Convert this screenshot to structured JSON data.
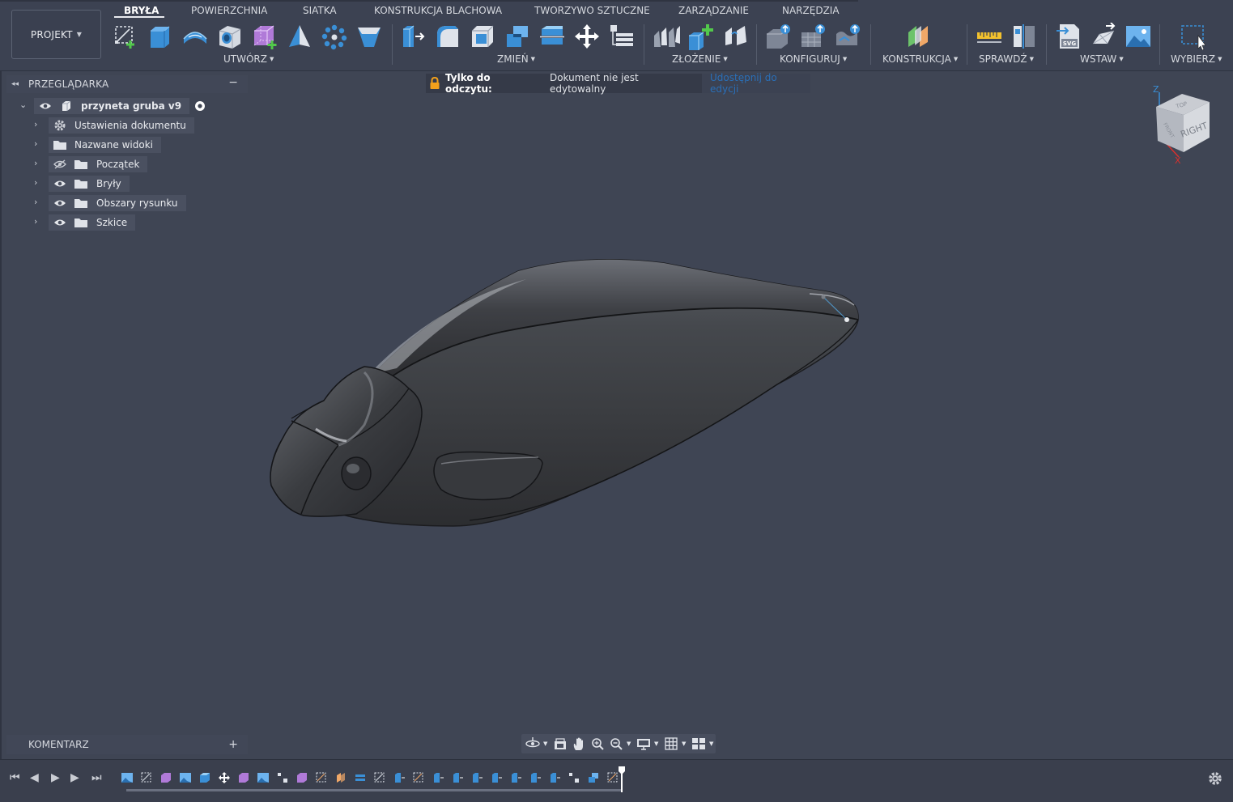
{
  "toolbar": {
    "project_button": "PROJEKT",
    "tabs": [
      "BRYŁA",
      "POWIERZCHNIA",
      "SIATKA",
      "KONSTRUKCJA BLACHOWA",
      "TWORZYWO SZTUCZNE",
      "ZARZĄDZANIE",
      "NARZĘDZIA"
    ],
    "active_tab": "BRYŁA",
    "groups": [
      "UTWÓRZ",
      "ZMIEŃ",
      "ZŁOŻENIE",
      "KONFIGURUJ",
      "KONSTRUKCJA",
      "SPRAWDŹ",
      "WSTAW",
      "WYBIERZ"
    ],
    "icons": {
      "create": [
        "create-sketch-icon",
        "extrude-icon",
        "revolve-icon",
        "hole-icon",
        "create-form-icon",
        "pyramid-icon",
        "pattern-icon",
        "shell-create-icon"
      ],
      "modify": [
        "press-pull-icon",
        "fillet-icon",
        "shell-icon",
        "combine-icon",
        "split-body-icon",
        "move-icon",
        "parameters-icon"
      ],
      "assemble": [
        "joint-icon",
        "new-component-icon",
        "rigid-group-icon"
      ],
      "configure": [
        "configure-table-icon",
        "configure-rows-icon",
        "configure-theme-icon"
      ],
      "construct": [
        "offset-plane-icon"
      ],
      "inspect": [
        "measure-icon",
        "section-analysis-icon"
      ],
      "insert": [
        "insert-svg-icon",
        "insert-mesh-icon",
        "insert-image-icon"
      ],
      "select": [
        "select-box-icon"
      ]
    },
    "svg_badge": "SVG"
  },
  "browser": {
    "title": "PRZEGLĄDARKA",
    "root": "przyneta gruba v9",
    "items": [
      {
        "label": "Ustawienia dokumentu",
        "icon": "gear-icon",
        "eye": "none"
      },
      {
        "label": "Nazwane widoki",
        "icon": "folder-icon",
        "eye": "none"
      },
      {
        "label": "Początek",
        "icon": "folder-icon",
        "eye": "hidden"
      },
      {
        "label": "Bryły",
        "icon": "folder-icon",
        "eye": "visible"
      },
      {
        "label": "Obszary rysunku",
        "icon": "folder-icon",
        "eye": "visible"
      },
      {
        "label": "Szkice",
        "icon": "folder-icon",
        "eye": "visible"
      }
    ]
  },
  "banner": {
    "title": "Tylko do odczytu:",
    "message": "Dokument nie jest edytowalny",
    "link": "Udostępnij do edycji"
  },
  "viewcube": {
    "face_right": "RIGHT",
    "face_top": "TOP",
    "face_front": "FRONT",
    "axis_z": "Z",
    "axis_x": "X"
  },
  "comments": {
    "title": "KOMENTARZ"
  },
  "colors": {
    "viewport_bg": "#3f4554",
    "toolbar_bg": "#3c4252",
    "accent_blue": "#3a8fd6",
    "link_blue": "#2a6fb7",
    "lock_orange": "#f2a01c"
  }
}
